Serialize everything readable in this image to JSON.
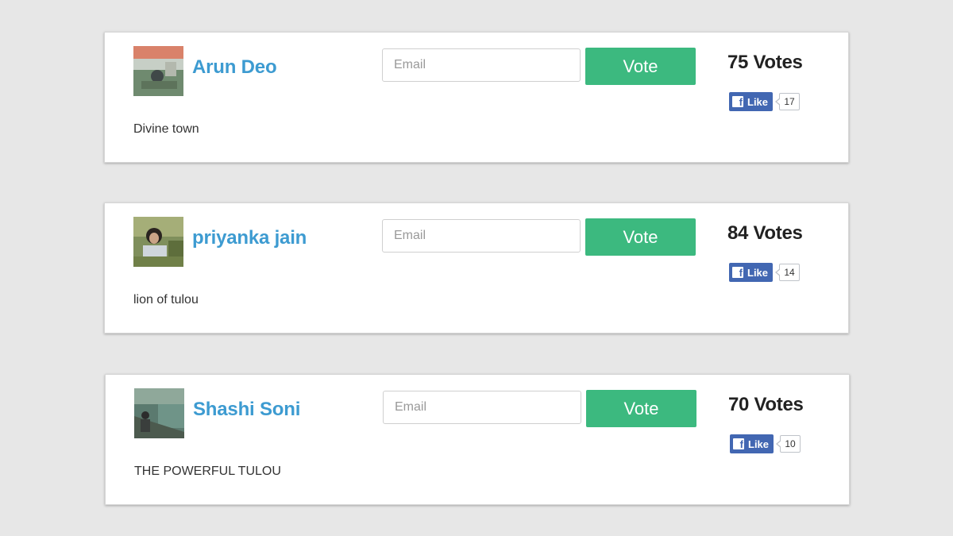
{
  "contestants": [
    {
      "name": "Arun Deo",
      "description": "Divine town",
      "email_placeholder": "Email",
      "vote_label": "Vote",
      "votes": "75 Votes",
      "like_label": "Like",
      "like_count": "17"
    },
    {
      "name": "priyanka jain",
      "description": "lion of tulou",
      "email_placeholder": "Email",
      "vote_label": "Vote",
      "votes": "84 Votes",
      "like_label": "Like",
      "like_count": "14"
    },
    {
      "name": "Shashi Soni",
      "description": "THE POWERFUL TULOU",
      "email_placeholder": "Email",
      "vote_label": "Vote",
      "votes": "70 Votes",
      "like_label": "Like",
      "like_count": "10"
    }
  ],
  "colors": {
    "background": "#e7e7e7",
    "name_link": "#3d9bd1",
    "vote_button": "#3cb97f",
    "facebook": "#4267b2"
  },
  "icons": {
    "facebook": "facebook-f-icon"
  }
}
